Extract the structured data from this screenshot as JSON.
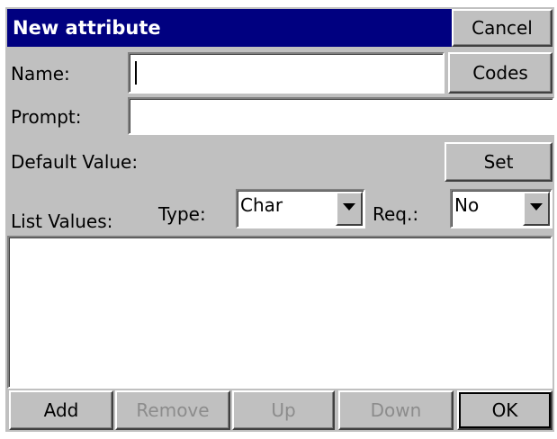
{
  "dialog": {
    "title": "New attribute",
    "cancel_label": "Cancel",
    "codes_label": "Codes",
    "set_label": "Set"
  },
  "form": {
    "name_label": "Name:",
    "name_value": "",
    "prompt_label": "Prompt:",
    "prompt_value": "",
    "default_value_label": "Default Value:",
    "list_values_label": "List Values:",
    "type_label": "Type:",
    "type_value": "Char",
    "req_label": "Req.:",
    "req_value": "No"
  },
  "list_values": [],
  "footer": {
    "add_label": "Add",
    "remove_label": "Remove",
    "up_label": "Up",
    "down_label": "Down",
    "ok_label": "OK"
  },
  "colors": {
    "titlebar": "#000080",
    "face": "#c0c0c0",
    "disabled_text": "#8c8c8c"
  }
}
